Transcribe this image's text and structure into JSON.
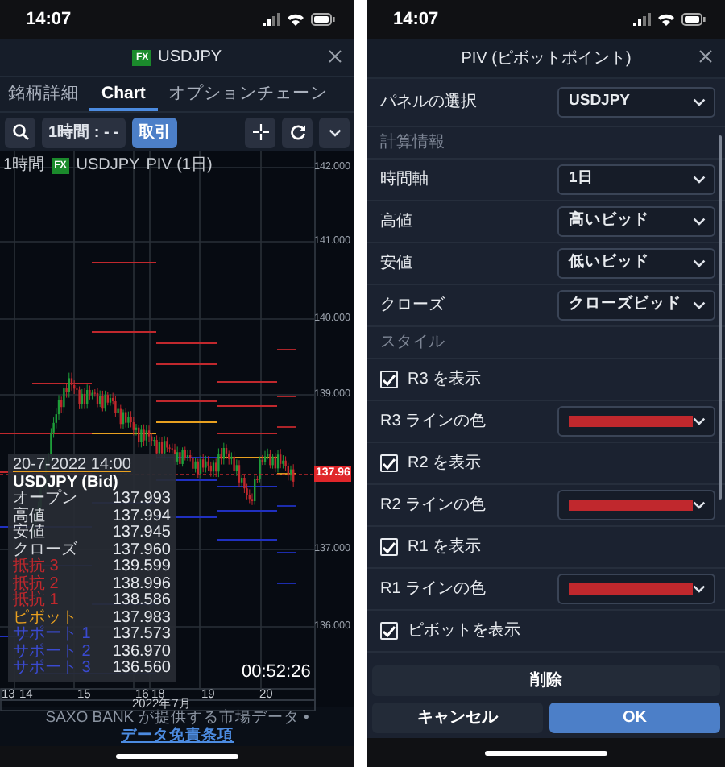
{
  "left_screen": {
    "status_bar": {
      "time": "14:07"
    },
    "header": {
      "badge": "FX",
      "symbol": "USDJPY"
    },
    "tabs": [
      {
        "label": "銘柄詳細",
        "selected": false
      },
      {
        "label": "Chart",
        "selected": true
      },
      {
        "label": "オプションチェーン",
        "selected": false
      }
    ],
    "toolbar": {
      "timeframe": "1時間 : - -",
      "trade": "取引"
    },
    "chart": {
      "legend": {
        "timeframe": "1時間",
        "badge": "FX",
        "symbol": "USDJPY",
        "indicator": "PIV (1日)"
      },
      "y_labels": [
        "142.000",
        "141.000",
        "140.000",
        "139.000",
        "137.000",
        "136.000"
      ],
      "price_tag": "137.96",
      "x_labels": [
        "13",
        "14",
        "15",
        "16",
        "18",
        "19",
        "20"
      ],
      "month": "2022年7月",
      "timer": "00:52:26",
      "tooltip": {
        "date": "20-7-2022 14:00",
        "title": "USDJPY (Bid)",
        "rows": [
          {
            "label": "オープン",
            "value": "137.993",
            "color": "#d8dbe0"
          },
          {
            "label": "高値",
            "value": "137.994",
            "color": "#d8dbe0"
          },
          {
            "label": "安値",
            "value": "137.945",
            "color": "#d8dbe0"
          },
          {
            "label": "クローズ",
            "value": "137.960",
            "color": "#d8dbe0"
          },
          {
            "label": "抵抗 3",
            "value": "139.599",
            "color": "#c0282d"
          },
          {
            "label": "抵抗 2",
            "value": "138.996",
            "color": "#c0282d"
          },
          {
            "label": "抵抗 1",
            "value": "138.586",
            "color": "#c0282d"
          },
          {
            "label": "ピボット",
            "value": "137.983",
            "color": "#e8a020"
          },
          {
            "label": "サポート 1",
            "value": "137.573",
            "color": "#3a4ad0"
          },
          {
            "label": "サポート 2",
            "value": "136.970",
            "color": "#3a4ad0"
          },
          {
            "label": "サポート 3",
            "value": "136.560",
            "color": "#3a4ad0"
          }
        ]
      }
    },
    "footer": {
      "text": "SAXO BANK が提供する市場データ",
      "separator": "•",
      "link": "データ免責条項"
    }
  },
  "right_screen": {
    "status_bar": {
      "time": "14:07"
    },
    "title": "PIV (ピボットポイント)",
    "rows": [
      {
        "kind": "select",
        "label": "パネルの選択",
        "value": "USDJPY"
      },
      {
        "kind": "section",
        "label": "計算情報"
      },
      {
        "kind": "select",
        "label": "時間軸",
        "value": "1日"
      },
      {
        "kind": "select",
        "label": "高値",
        "value": "高いビッド"
      },
      {
        "kind": "select",
        "label": "安値",
        "value": "低いビッド"
      },
      {
        "kind": "select",
        "label": "クローズ",
        "value": "クローズビッド"
      },
      {
        "kind": "section",
        "label": "スタイル"
      },
      {
        "kind": "checkbox",
        "label": "R3 を表示",
        "checked": true
      },
      {
        "kind": "color",
        "label": "R3 ラインの色",
        "color": "#c0282d"
      },
      {
        "kind": "checkbox",
        "label": "R2 を表示",
        "checked": true
      },
      {
        "kind": "color",
        "label": "R2 ラインの色",
        "color": "#c0282d"
      },
      {
        "kind": "checkbox",
        "label": "R1 を表示",
        "checked": true
      },
      {
        "kind": "color",
        "label": "R1 ラインの色",
        "color": "#c0282d"
      },
      {
        "kind": "checkbox",
        "label": "ピボットを表示",
        "checked": true
      }
    ],
    "delete_button": "削除",
    "cancel_button": "キャンセル",
    "ok_button": "OK"
  }
}
